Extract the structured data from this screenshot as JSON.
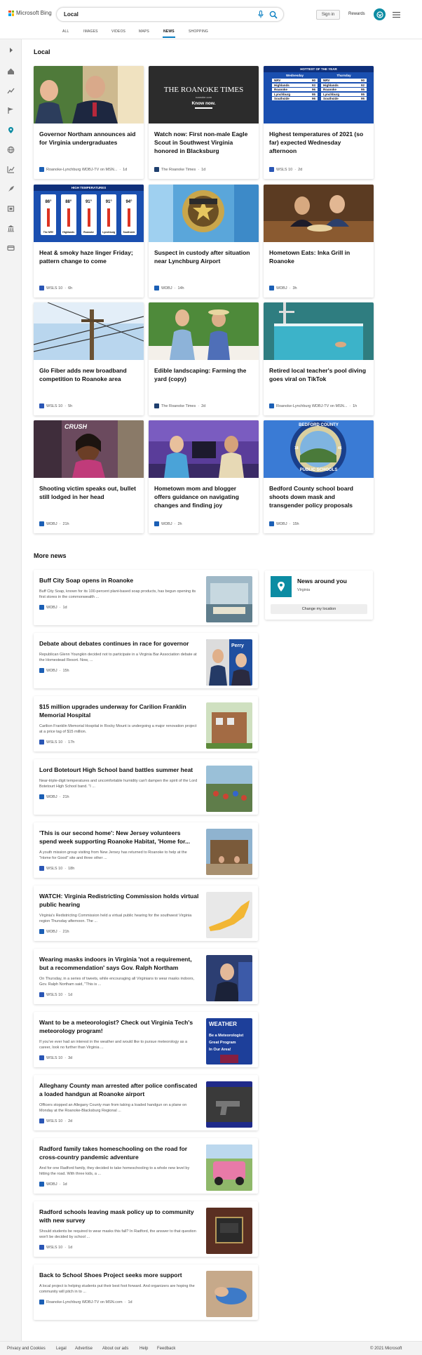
{
  "header": {
    "brand": "Microsoft Bing",
    "search_value": "Local",
    "signin_label": "Sign in",
    "rewards_label": "Rewards"
  },
  "tabs": [
    "ALL",
    "IMAGES",
    "VIDEOS",
    "MAPS",
    "NEWS",
    "SHOPPING"
  ],
  "active_tab": "NEWS",
  "local": {
    "title": "Local",
    "cards": [
      {
        "title": "Governor Northam announces aid for Virginia undergraduates",
        "source": "Roanoke-Lynchburg WDBJ-TV on MSN...",
        "time": "1d"
      },
      {
        "title": "Watch now: First non-male Eagle Scout in Southwest Virginia honored in Blacksburg",
        "source": "The Roanoke Times",
        "time": "1d"
      },
      {
        "title": "Highest temperatures of 2021 (so far) expected Wednesday afternoon",
        "source": "WSLS 10",
        "time": "2d"
      },
      {
        "title": "Heat & smoky haze linger Friday; pattern change to come",
        "source": "WSLS 10",
        "time": "6h"
      },
      {
        "title": "Suspect in custody after situation near Lynchburg Airport",
        "source": "WDBJ",
        "time": "14h"
      },
      {
        "title": "Hometown Eats: Inka Grill in Roanoke",
        "source": "WDBJ",
        "time": "3h"
      },
      {
        "title": "Glo Fiber adds new broadband competition to Roanoke area",
        "source": "WSLS 10",
        "time": "5h"
      },
      {
        "title": "Edible landscaping: Farming the yard (copy)",
        "source": "The Roanoke Times",
        "time": "2d"
      },
      {
        "title": "Retired local teacher's pool diving goes viral on TikTok",
        "source": "Roanoke-Lynchburg WDBJ-TV on MSN...",
        "time": "1h"
      },
      {
        "title": "Shooting victim speaks out, bullet still lodged in her head",
        "source": "WDBJ",
        "time": "21h"
      },
      {
        "title": "Hometown mom and blogger offers guidance on navigating changes and finding joy",
        "source": "WDBJ",
        "time": "2h"
      },
      {
        "title": "Bedford County school board shoots down mask and transgender policy proposals",
        "source": "WDBJ",
        "time": "15h"
      }
    ],
    "image_text": {
      "roanoke_times": "THE ROANOKE TIMES",
      "roanoke_times_url": "roanoke.com",
      "know_now": "Know now.",
      "hottest": "HOTTEST OF THE YEAR",
      "wednesday": "Wednesday",
      "thursday": "Thursday",
      "cities": [
        "NRV",
        "Highlands",
        "Roanoke",
        "Lynchburg",
        "Southside"
      ],
      "wed_temps": [
        "90",
        "93",
        "96",
        "95",
        "96"
      ],
      "thu_temps": [
        "90",
        "92",
        "95",
        "95",
        "95"
      ],
      "high_temps": "HIGH TEMPERATURES",
      "thermo_temps": [
        "86°",
        "88°",
        "91°",
        "91°",
        "94°"
      ],
      "thermo_cities": [
        "The NRV",
        "Highlands",
        "Roanoke",
        "Lynchburg",
        "Southside"
      ],
      "crush": "CRUSH",
      "bedford_top": "BEDFORD COUNTY",
      "bedford_bottom": "PUBLIC SCHOOLS",
      "bedford_y1": "18",
      "bedford_y2": "46"
    }
  },
  "more_news": {
    "title": "More news",
    "items": [
      {
        "title": "Buff City Soap opens in Roanoke",
        "snippet": "Buff City Soap, known for its 100-percent plant-based soap products, has begun opening its first stores in the commonwealth ...",
        "source": "WDBJ",
        "time": "1d"
      },
      {
        "title": "Debate about debates continues in race for governor",
        "snippet": "Republican Glenn Youngkin decided not to participate in a Virginia Bar Association debate at the Homestead Resort. Now, ...",
        "source": "WDBJ",
        "time": "15h"
      },
      {
        "title": "$15 million upgrades underway for Carilion Franklin Memorial Hospital",
        "snippet": "Carilion Franklin Memorial Hospital in Rocky Mount is undergoing a major renovation project at a price tag of $15 million.",
        "source": "WSLS 10",
        "time": "17h"
      },
      {
        "title": "Lord Botetourt High School band battles summer heat",
        "snippet": "Near-triple-digit temperatures and uncomfortable humidity can't dampen the spirit of the Lord Botetourt High School band. \"I ...",
        "source": "WDBJ",
        "time": "21h"
      },
      {
        "title": "'This is our second home': New Jersey volunteers spend week supporting Roanoke Habitat, 'Home for...",
        "snippet": "A youth mission group visiting from New Jersey has returned to Roanoke to help at the \"Home for Good\" site and three other ...",
        "source": "WSLS 10",
        "time": "18h"
      },
      {
        "title": "WATCH: Virginia Redistricting Commission holds virtual public hearing",
        "snippet": "Virginia's Redistricting Commission held a virtual public hearing for the southwest Virginia region Thursday afternoon. The ...",
        "source": "WDBJ",
        "time": "21h"
      },
      {
        "title": "Wearing masks indoors in Virginia 'not a requirement, but a recommendation' says Gov. Ralph Northam",
        "snippet": "On Thursday, in a series of tweets, while encouraging all Virginians to wear masks indoors, Gov. Ralph Northam said, \"This is ...",
        "source": "WSLS 10",
        "time": "1d"
      },
      {
        "title": "Want to be a meteorologist? Check out Virginia Tech's meteorology program!",
        "snippet": "If you've ever had an interest in the weather and would like to pursue meteorology as a career, look no further than Virginia ...",
        "source": "WSLS 10",
        "time": "3d"
      },
      {
        "title": "Alleghany County man arrested after police confiscated a loaded handgun at Roanoke airport",
        "snippet": "Officers stopped an Allegany County man from taking a loaded handgun on a plane on Monday at the Roanoke-Blacksburg Regional ...",
        "source": "WSLS 10",
        "time": "2d"
      },
      {
        "title": "Radford family takes homeschooling on the road for cross-country pandemic adventure",
        "snippet": "And for one Radford family, they decided to take homeschooling to a whole new level by hitting the road. With three kids, a ...",
        "source": "WDBJ",
        "time": "1d"
      },
      {
        "title": "Radford schools leaving mask policy up to community with new survey",
        "snippet": "Should students be required to wear masks this fall? In Radford, the answer to that question won't be decided by school ...",
        "source": "WSLS 10",
        "time": "1d"
      },
      {
        "title": "Back to School Shoes Project seeks more support",
        "snippet": "A local project is helping students put their best foot forward. And organizers are hoping the community will pitch in to ...",
        "source": "Roanoke-Lynchburg WDBJ-TV on MSN.com",
        "time": "1d"
      }
    ],
    "thumb_text": {
      "perry": "Perry",
      "weather": "WEATHER",
      "meteorologist": "Be a Meteorologist",
      "great_program": "Great Program",
      "in_our_area": "In Our Area!"
    }
  },
  "sidebar_card": {
    "title": "News around you",
    "location": "Virginia",
    "button": "Change my location"
  },
  "footer": {
    "links": [
      "Privacy and Cookies",
      "Legal",
      "Advertise",
      "About our ads",
      "Help",
      "Feedback"
    ],
    "copyright": "© 2021 Microsoft"
  },
  "colors": {
    "accent": "#0a7fc2",
    "teal": "#0c8ca3",
    "wdbj": "#1b5fb5",
    "wsls": "#2a56b5",
    "roanoke_times": "#1f3f6e"
  }
}
